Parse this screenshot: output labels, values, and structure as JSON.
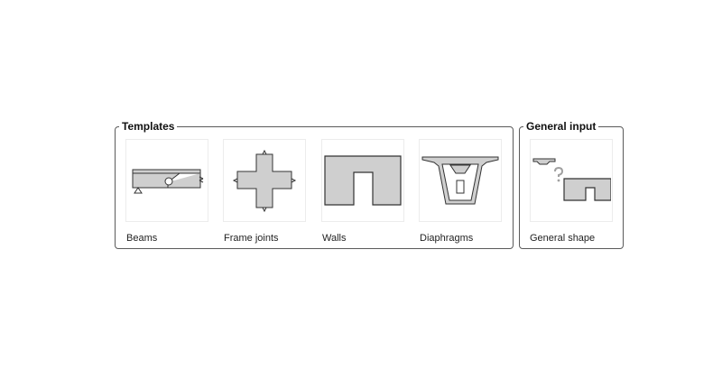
{
  "templates": {
    "title": "Templates",
    "items": [
      {
        "label": "Beams",
        "icon": "beam-icon"
      },
      {
        "label": "Frame joints",
        "icon": "frame-joint-icon"
      },
      {
        "label": "Walls",
        "icon": "wall-icon"
      },
      {
        "label": "Diaphragms",
        "icon": "diaphragm-icon"
      }
    ]
  },
  "general_input": {
    "title": "General input",
    "items": [
      {
        "label": "General shape",
        "icon": "general-shape-icon"
      }
    ]
  },
  "colors": {
    "shape_fill": "#cfcfcf",
    "shape_stroke": "#333333",
    "frame_border": "#5a5a5a",
    "tile_border": "#ececec"
  }
}
